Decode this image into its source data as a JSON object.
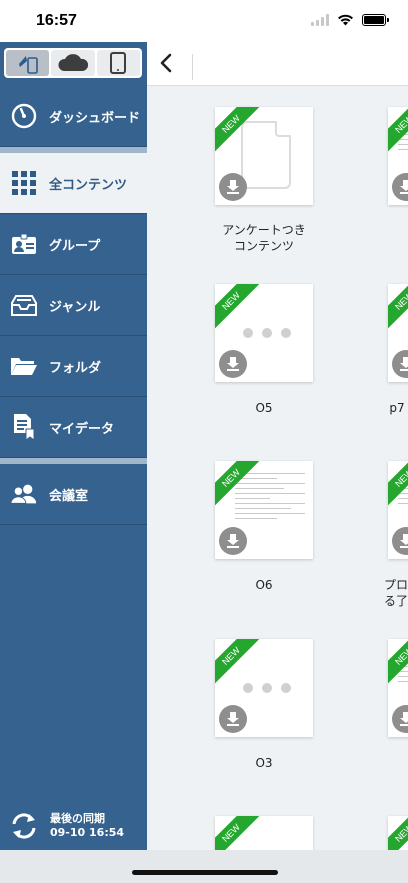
{
  "status_bar": {
    "time": "16:57"
  },
  "sidebar": {
    "segments": [
      {
        "icon": "device-sync-icon",
        "active": true
      },
      {
        "icon": "cloud-icon",
        "active": false
      },
      {
        "icon": "tablet-icon",
        "active": false
      }
    ],
    "items": [
      {
        "label": "ダッシュボード",
        "icon": "dashboard-gauge-icon"
      },
      {
        "label": "全コンテンツ",
        "icon": "grid-icon",
        "active": true
      },
      {
        "label": "グループ",
        "icon": "group-badge-icon"
      },
      {
        "label": "ジャンル",
        "icon": "tray-icon"
      },
      {
        "label": "フォルダ",
        "icon": "folder-icon"
      },
      {
        "label": "マイデータ",
        "icon": "my-data-icon"
      },
      {
        "label": "会議室",
        "icon": "meeting-room-icon"
      }
    ],
    "sync": {
      "title": "最後の同期",
      "datetime": "09-10 16:54"
    }
  },
  "content": {
    "badge": "NEW",
    "items": [
      {
        "title": "アンケートつき\nコンテンツ",
        "thumb": "blank-doc"
      },
      {
        "title": "O5",
        "thumb": "loading"
      },
      {
        "title": "p7",
        "thumb": "loading"
      },
      {
        "title": "O6",
        "thumb": "document"
      },
      {
        "title": "プロ\nる了",
        "thumb": "document"
      },
      {
        "title": "O3",
        "thumb": "loading"
      }
    ]
  },
  "colors": {
    "sidebar": "#35628f",
    "ribbon": "#25a72f",
    "active_bg": "#eef2f4"
  }
}
